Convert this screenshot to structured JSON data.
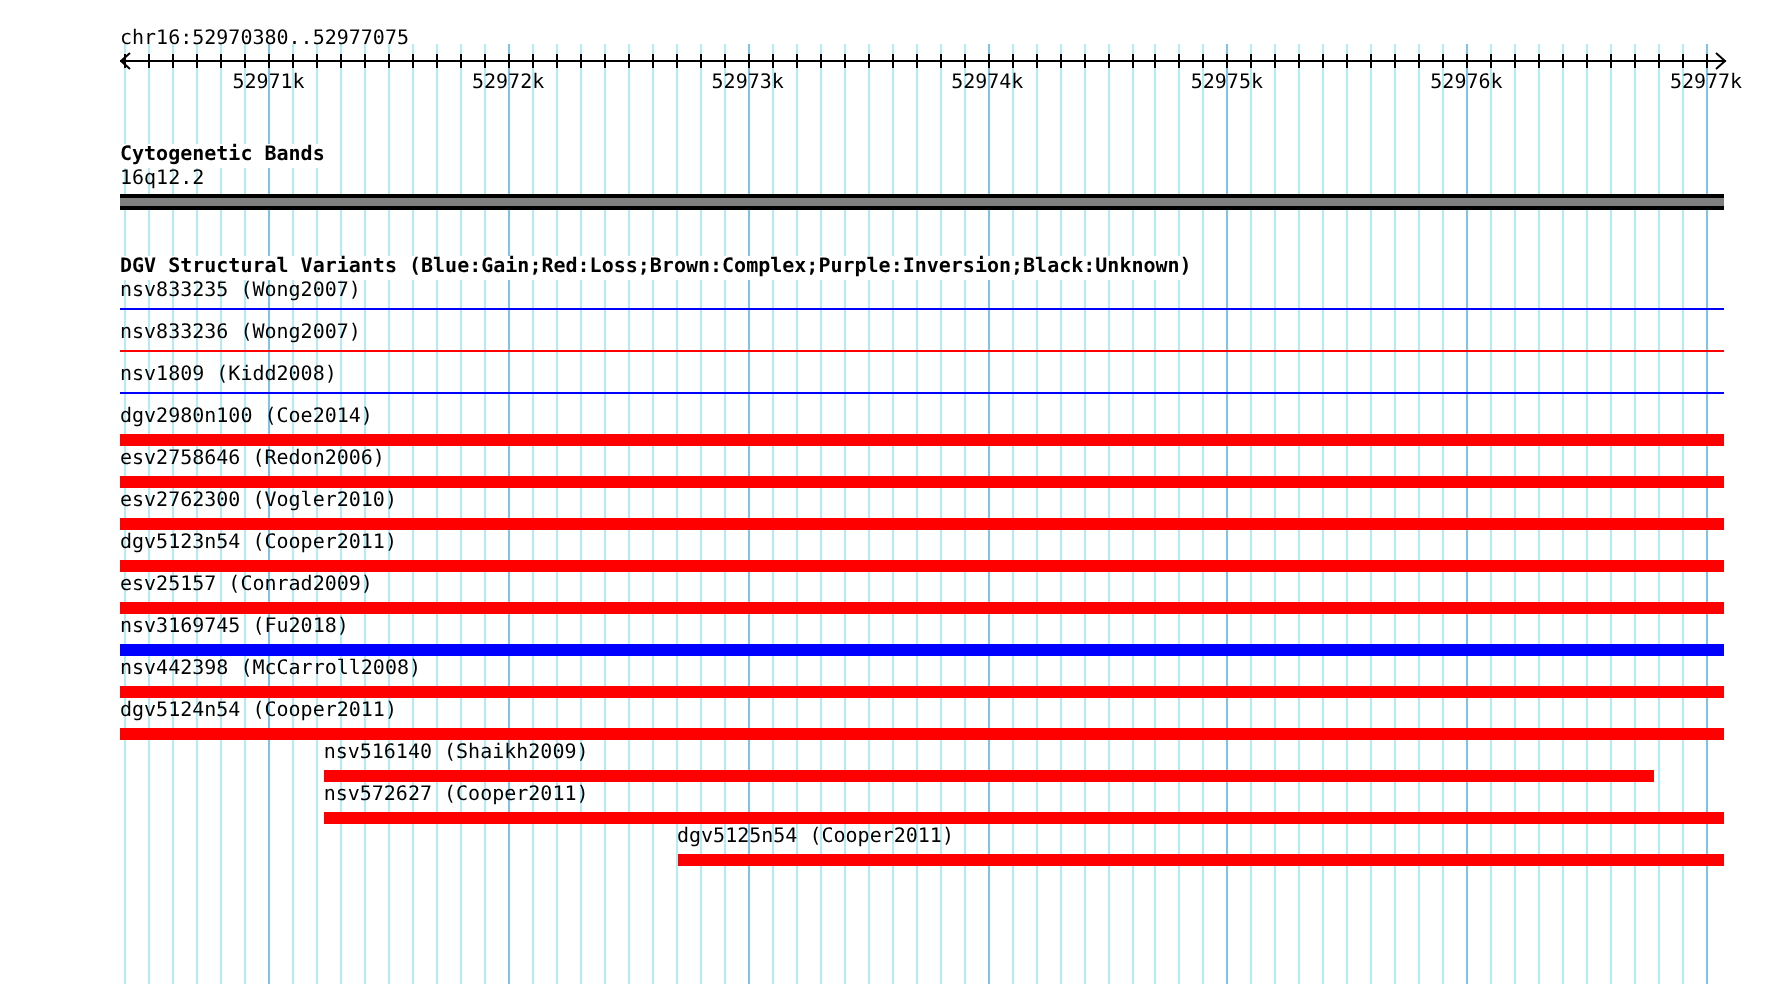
{
  "ruler": {
    "region": "chr16:52970380..52977075",
    "ticks": [
      {
        "label": "52971k"
      },
      {
        "label": "52972k"
      },
      {
        "label": "52973k"
      },
      {
        "label": "52974k"
      },
      {
        "label": "52975k"
      },
      {
        "label": "52976k"
      },
      {
        "label": "52977k"
      }
    ]
  },
  "cytoband_track": {
    "title": "Cytogenetic Bands",
    "band": "16q12.2",
    "color": "#808080"
  },
  "variant_track": {
    "title": "DGV Structural Variants (Blue:Gain;Red:Loss;Brown:Complex;Purple:Inversion;Black:Unknown)",
    "features": [
      {
        "label": "nsv833235 (Wong2007)",
        "kind": "thin",
        "color": "#0000ff"
      },
      {
        "label": "nsv833236 (Wong2007)",
        "kind": "thin",
        "color": "#ff0000"
      },
      {
        "label": "nsv1809 (Kidd2008)",
        "kind": "thin",
        "color": "#0000ff"
      },
      {
        "label": "dgv2980n100 (Coe2014)",
        "kind": "thick",
        "color": "#ff0000"
      },
      {
        "label": "esv2758646 (Redon2006)",
        "kind": "thick",
        "color": "#ff0000"
      },
      {
        "label": "esv2762300 (Vogler2010)",
        "kind": "thick",
        "color": "#ff0000"
      },
      {
        "label": "dgv5123n54 (Cooper2011)",
        "kind": "thick",
        "color": "#ff0000"
      },
      {
        "label": "esv25157 (Conrad2009)",
        "kind": "thick",
        "color": "#ff0000"
      },
      {
        "label": "nsv3169745 (Fu2018)",
        "kind": "thick",
        "color": "#0000ff"
      },
      {
        "label": "nsv442398 (McCarroll2008)",
        "kind": "thick",
        "color": "#ff0000"
      },
      {
        "label": "dgv5124n54 (Cooper2011)",
        "kind": "thick",
        "color": "#ff0000"
      },
      {
        "label": "nsv516140 (Shaikh2009)",
        "kind": "thick",
        "color": "#ff0000"
      },
      {
        "label": "nsv572627 (Cooper2011)",
        "kind": "thick",
        "color": "#ff0000"
      },
      {
        "label": "dgv5125n54 (Cooper2011)",
        "kind": "thick",
        "color": "#ff0000"
      }
    ]
  }
}
